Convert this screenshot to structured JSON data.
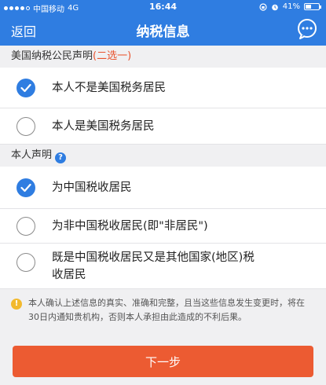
{
  "status_bar": {
    "carrier": "中国移动",
    "network": "4G",
    "time": "16:44",
    "battery": "41%",
    "battery_level": 0.41
  },
  "nav": {
    "back_label": "返回",
    "title": "纳税信息"
  },
  "section1": {
    "title": "美国纳税公民声明",
    "hint": "(二选一)",
    "options": [
      {
        "label": "本人不是美国税务居民",
        "checked": true
      },
      {
        "label": "本人是美国税务居民",
        "checked": false
      }
    ]
  },
  "section2": {
    "title": "本人声明",
    "help_icon": "?",
    "options": [
      {
        "label": "为中国税收居民",
        "checked": true
      },
      {
        "label": "为非中国税收居民(即\"非居民\")",
        "checked": false
      },
      {
        "label_line1": "既是中国税收居民又是其他国家(地区)税",
        "label_line2": "收居民",
        "checked": false
      }
    ]
  },
  "notice": {
    "icon": "!",
    "text": "本人确认上述信息的真实、准确和完整，且当这些信息发生变更时，将在30日内通知贵机构，否则本人承担由此造成的不利后果。"
  },
  "next_button": {
    "label": "下一步"
  },
  "colors": {
    "primary": "#2f7de1",
    "accent": "#ec5b32",
    "hint": "#e8532f",
    "warning": "#f2b92e"
  }
}
